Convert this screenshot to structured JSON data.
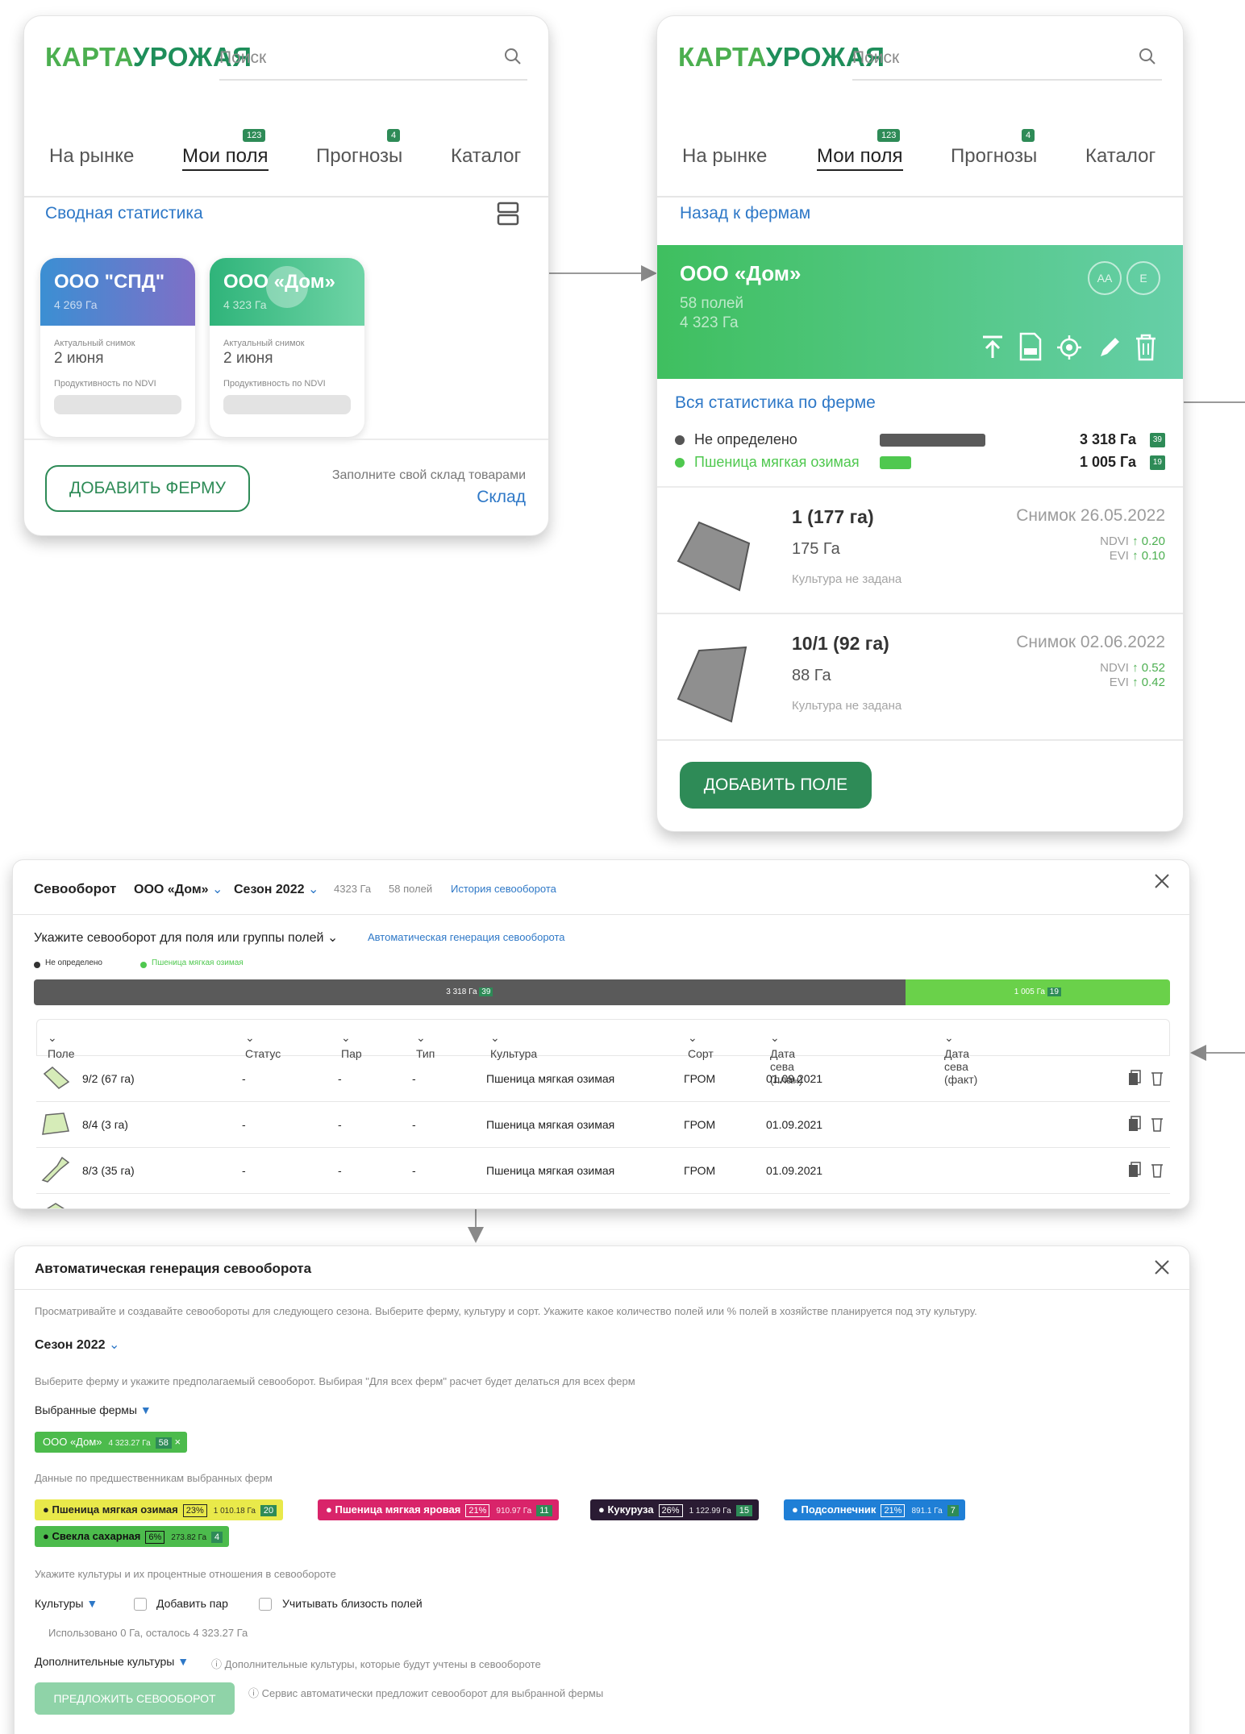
{
  "app": {
    "logo_part1": "КАРТА",
    "logo_part2": "УРОЖАЯ",
    "search_placeholder": "Поиск",
    "tabs": [
      {
        "label": "На рынке",
        "badge": ""
      },
      {
        "label": "Мои поля",
        "badge": "123"
      },
      {
        "label": "Прогнозы",
        "badge": "4"
      },
      {
        "label": "Каталог",
        "badge": ""
      }
    ]
  },
  "screen1": {
    "summary_link": "Сводная статистика",
    "farms": [
      {
        "name": "ООО \"СПД\"",
        "area": "4 269 Га",
        "snapshot_label": "Актуальный снимок",
        "snapshot_date": "2 июня",
        "ndvi_label": "Продуктивность по NDVI"
      },
      {
        "name": "ООО «Дом»",
        "area": "4 323 Га",
        "snapshot_label": "Актуальный снимок",
        "snapshot_date": "2 июня",
        "ndvi_label": "Продуктивность по NDVI"
      }
    ],
    "add_farm_button": "ДОБАВИТЬ ФЕРМУ",
    "warehouse_hint": "Заполните свой склад товарами",
    "warehouse_link": "Склад"
  },
  "screen2": {
    "back_link": "Назад к фермам",
    "farm_name": "ООО «Дом»",
    "fields_count": "58 полей",
    "farm_area": "4 323 Га",
    "avatar_1": "АА",
    "avatar_2": "Е",
    "all_stats_link": "Вся статистика по ферме",
    "stats": [
      {
        "label": "Не определено",
        "value": "3 318 Га",
        "count": "39",
        "fraction": 0.77,
        "color": "#555555"
      },
      {
        "label": "Пшеница мягкая озимая",
        "value": "1 005 Га",
        "count": "19",
        "fraction": 0.23,
        "color": "#4fc84f"
      }
    ],
    "fields": [
      {
        "title": "1 (177 га)",
        "area": "175 Га",
        "note": "Культура не задана",
        "snapshot": "Снимок 26.05.2022",
        "ndvi_label": "NDVI",
        "ndvi": "0.20",
        "evi_label": "EVI",
        "evi": "0.10"
      },
      {
        "title": "10/1 (92 га)",
        "area": "88 Га",
        "note": "Культура не задана",
        "snapshot": "Снимок 02.06.2022",
        "ndvi_label": "NDVI",
        "ndvi": "0.52",
        "evi_label": "EVI",
        "evi": "0.42"
      }
    ],
    "add_field_button": "ДОБАВИТЬ ПОЛЕ"
  },
  "rotation": {
    "title": "Севооборот",
    "farm": "ООО «Дом»",
    "season": "Сезон 2022",
    "area": "4323 Га",
    "fields": "58 полей",
    "history_link": "История севооборота",
    "specify_label": "Укажите севооборот для поля или группы полей",
    "auto_link": "Автоматическая генерация севооборота",
    "legend": [
      {
        "label": "Не определено",
        "color": "#333333"
      },
      {
        "label": "Пшеница мягкая озимая",
        "color": "#4fc84f"
      }
    ],
    "bar": [
      {
        "value": "3 318 Га",
        "count": "39",
        "fraction": 0.767,
        "color": "#5a5a5a"
      },
      {
        "value": "1 005 Га",
        "count": "19",
        "fraction": 0.233,
        "color": "#6ad14a"
      }
    ],
    "columns": [
      "Поле",
      "Статус",
      "Пар",
      "Тип",
      "Культура",
      "Сорт",
      "Дата сева (план)",
      "Дата сева (факт)"
    ],
    "rows": [
      {
        "field": "9/2 (67 га)",
        "status": "-",
        "par": "-",
        "type": "-",
        "crop": "Пшеница мягкая озимая",
        "sort": "ГРОМ",
        "plan": "01.09.2021",
        "fact": ""
      },
      {
        "field": "8/4 (3 га)",
        "status": "-",
        "par": "-",
        "type": "-",
        "crop": "Пшеница мягкая озимая",
        "sort": "ГРОМ",
        "plan": "01.09.2021",
        "fact": ""
      },
      {
        "field": "8/3 (35 га)",
        "status": "-",
        "par": "-",
        "type": "-",
        "crop": "Пшеница мягкая озимая",
        "sort": "ГРОМ",
        "plan": "01.09.2021",
        "fact": ""
      }
    ]
  },
  "generator": {
    "title": "Автоматическая генерация севооборота",
    "description": "Просматривайте и создавайте севообороты для следующего сезона. Выберите ферму, культуру и сорт. Укажите какое количество полей или % полей в хозяйстве планируется под эту культуру.",
    "season": "Сезон 2022",
    "farm_hint": "Выберите ферму и укажите предполагаемый севооборот. Выбирая \"Для всех ферм\" расчет будет делаться для всех ферм",
    "selected_farms_label": "Выбранные фермы",
    "selected_farm": {
      "name": "ООО «Дом»",
      "area": "4 323.27 Га",
      "count": "58"
    },
    "predecessors_label": "Данные по предшественникам выбранных ферм",
    "predecessors": [
      {
        "name": "Пшеница мягкая озимая",
        "pct": "23%",
        "ha": "1 010.18 Га",
        "count": "20",
        "bg": "#e9e94a",
        "fg": "#222222"
      },
      {
        "name": "Пшеница мягкая яровая",
        "pct": "21%",
        "ha": "910.97 Га",
        "count": "11",
        "bg": "#d9246a",
        "fg": "#ffffff"
      },
      {
        "name": "Кукуруза",
        "pct": "26%",
        "ha": "1 122.99 Га",
        "count": "15",
        "bg": "#2a1b33",
        "fg": "#ffffff"
      },
      {
        "name": "Подсолнечник",
        "pct": "21%",
        "ha": "891.1 Га",
        "count": "7",
        "bg": "#1f7fd6",
        "fg": "#ffffff"
      },
      {
        "name": "Свекла сахарная",
        "pct": "6%",
        "ha": "273.82 Га",
        "count": "4",
        "bg": "#4cbb4c",
        "fg": "#111111"
      }
    ],
    "crops_hint": "Укажите культуры и их процентные отношения в севообороте",
    "crops_label": "Культуры",
    "add_par": "Добавить пар",
    "proximity": "Учитывать близость полей",
    "used": "Использовано 0 Га, осталось 4 323.27 Га",
    "extra_label": "Дополнительные культуры",
    "extra_hint": "Дополнительные культуры, которые будут учтены в севообороте",
    "suggest_button": "ПРЕДЛОЖИТЬ СЕВООБОРОТ",
    "suggest_hint": "Сервис автоматически предложит севооборот для выбранной фермы"
  }
}
